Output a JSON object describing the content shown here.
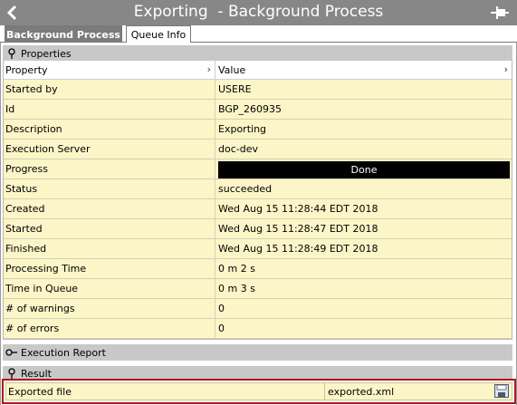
{
  "window": {
    "title": "Exporting  - Background Process",
    "back_icon": "chevron-left-icon",
    "pin_icon": "pin-icon"
  },
  "tabs": [
    {
      "label": "Background Process",
      "active": true
    },
    {
      "label": "Queue Info",
      "active": false
    }
  ],
  "properties_section": {
    "title": "Properties",
    "expanded": true,
    "columns": [
      "Property",
      "Value"
    ],
    "rows": [
      {
        "property": "Started by",
        "value": "USERE"
      },
      {
        "property": "Id",
        "value": "BGP_260935"
      },
      {
        "property": "Description",
        "value": "Exporting"
      },
      {
        "property": "Execution Server",
        "value": "doc-dev"
      },
      {
        "property": "Progress",
        "value": "Done",
        "progress_fraction": 1.0
      },
      {
        "property": "Status",
        "value": "succeeded"
      },
      {
        "property": "Created",
        "value": "Wed Aug 15 11:28:44 EDT 2018"
      },
      {
        "property": "Started",
        "value": "Wed Aug 15 11:28:47 EDT 2018"
      },
      {
        "property": "Finished",
        "value": "Wed Aug 15 11:28:49 EDT 2018"
      },
      {
        "property": "Processing Time",
        "value": "0 m 2 s"
      },
      {
        "property": "Time in Queue",
        "value": "0 m 3 s"
      },
      {
        "property": "# of warnings",
        "value": "0"
      },
      {
        "property": "# of errors",
        "value": "0"
      }
    ]
  },
  "execution_report_section": {
    "title": "Execution Report",
    "expanded": false
  },
  "result_section": {
    "title": "Result",
    "expanded": true,
    "row": {
      "property": "Exported file",
      "value": "exported.xml",
      "action_icon": "save-icon"
    }
  },
  "colors": {
    "titlebar": "#878787",
    "active_tab": "#7b7b7b",
    "section_header": "#c8c8c8",
    "row_background": "#fcf5c8",
    "progress_bar": "#000000",
    "highlight_border": "#b01616"
  }
}
